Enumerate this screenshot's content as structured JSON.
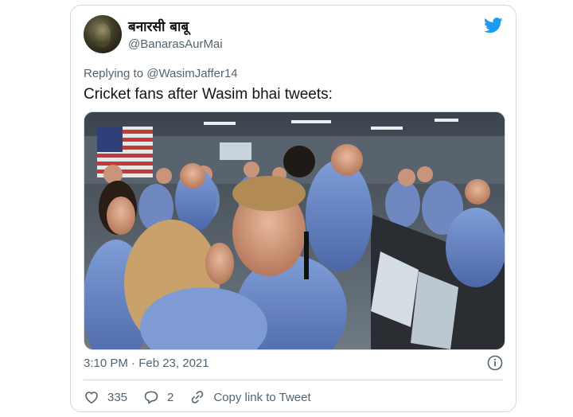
{
  "tweet": {
    "display_name": "बनारसी बाबू",
    "handle": "@BanarasAurMai",
    "replying_prefix": "Replying to",
    "replying_to": "@WasimJaffer14",
    "text": "Cricket fans after Wasim bhai tweets:",
    "time": "3:10 PM · Feb 23, 2021",
    "likes": "335",
    "replies": "2",
    "copy_link_label": "Copy link to Tweet"
  },
  "icons": {
    "brand": "twitter-bird-icon",
    "info": "info-icon",
    "like": "heart-icon",
    "reply": "reply-icon",
    "link": "link-icon"
  },
  "colors": {
    "brand": "#1d9bf0",
    "muted": "#536471",
    "border": "#cfd9de"
  }
}
